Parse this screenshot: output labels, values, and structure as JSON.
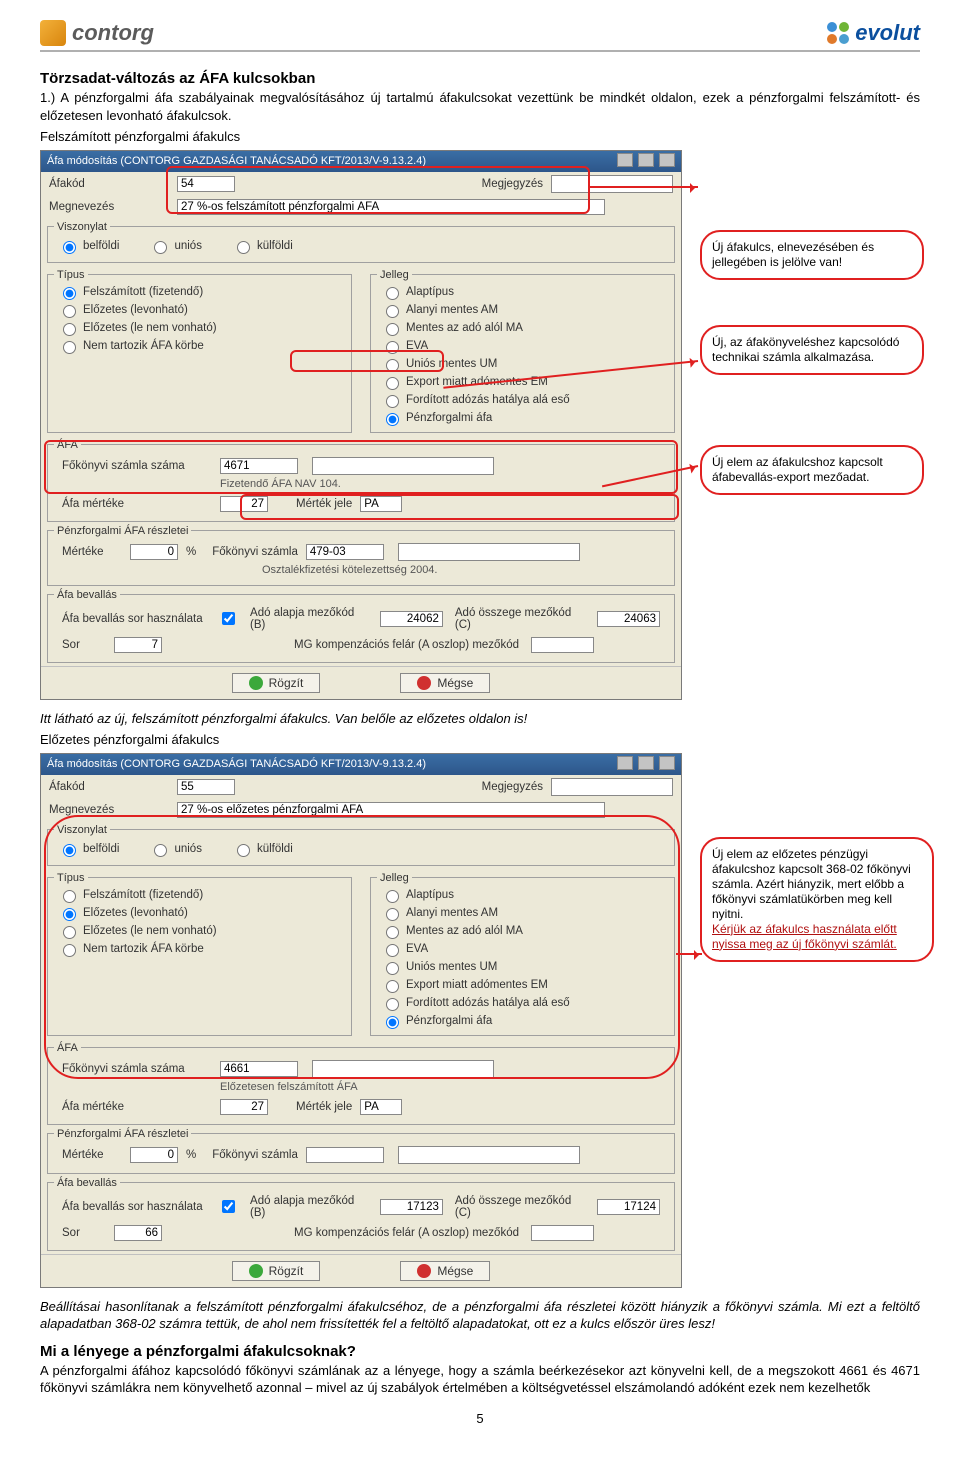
{
  "header": {
    "left_logo": "contorg",
    "right_logo": "evolut"
  },
  "section_title": "Törzsadat-változás az ÁFA kulcsokban",
  "intro_para": "1.) A pénzforgalmi áfa szabályainak megvalósításához új tartalmú áfakulcsokat vezettünk be mindkét oldalon, ezek a pénzforgalmi felszámított- és előzetesen levonható áfakulcsok.",
  "sub1_label": "Felszámított pénzforgalmi áfakulcs",
  "dialog1": {
    "title": "Áfa módosítás (CONTORG GAZDASÁGI TANÁCSADÓ KFT/2013/V-9.13.2.4)",
    "afakod_label": "Áfakód",
    "afakod_value": "54",
    "megjegyzes_label": "Megjegyzés",
    "megnevezes_label": "Megnevezés",
    "megnevezes_value": "27 %-os felszámított pénzforgalmi ÁFA",
    "viszonylat_legend": "Viszonylat",
    "visz_opts": [
      "belföldi",
      "uniós",
      "külföldi"
    ],
    "tipus_legend": "Típus",
    "tipus_opts": [
      "Felszámított (fizetendő)",
      "Előzetes (levonható)",
      "Előzetes (le nem vonható)",
      "Nem tartozik ÁFA körbe"
    ],
    "jelleg_legend": "Jelleg",
    "jelleg_opts": [
      "Alaptípus",
      "Alanyi mentes AM",
      "Mentes az adó alól MA",
      "EVA",
      "Uniós mentes UM",
      "Export miatt adómentes EM",
      "Fordított adózás hatálya alá eső",
      "Pénzforgalmi áfa"
    ],
    "afa_legend": "ÁFA",
    "fokonyvi_label": "Főkönyvi számla száma",
    "fokonyvi_value": "4671",
    "fizetendo_label": "Fizetendő ÁFA NAV 104.",
    "merteke_label": "Áfa mértéke",
    "merteke_value": "27",
    "mertekjele_label": "Mérték jele",
    "mertekjele_value": "PA",
    "penz_legend": "Pénzforgalmi ÁFA részletei",
    "penz_merteke_label": "Mértéke",
    "penz_merteke_value": "0",
    "penz_pct": "%",
    "penz_fk_label": "Főkönyvi számla",
    "penz_fk_value": "479-03",
    "osztalek_label": "Osztalékfizetési kötelezettség 2004.",
    "bevallas_legend": "Áfa bevallás",
    "bev_sor_label": "Áfa bevallás sor használata",
    "bev_sor_chk": true,
    "ado_b_label": "Adó alapja mezőkód (B)",
    "ado_b_value": "24062",
    "ado_c_label": "Adó összege mezőkód (C)",
    "ado_c_value": "24063",
    "sor_label": "Sor",
    "sor_value": "7",
    "mg_label": "MG kompenzációs felár (A oszlop) mezőkód",
    "btn_save": "Rögzít",
    "btn_cancel": "Mégse"
  },
  "callouts1": {
    "a": "Új áfakulcs, elnevezésében és jellegében is jelölve van!",
    "b": "Új, az áfakönyveléshez kapcsolódó technikai számla alkalmazása.",
    "c": "Új elem az áfakulcshoz kapcsolt áfabevallás-export mezőadat."
  },
  "mid_italic": "Itt látható az új, felszámított pénzforgalmi áfakulcs. Van belőle az előzetes oldalon is!",
  "sub2_label": "Előzetes pénzforgalmi áfakulcs",
  "dialog2": {
    "title": "Áfa módosítás (CONTORG GAZDASÁGI TANÁCSADÓ KFT/2013/V-9.13.2.4)",
    "afakod_value": "55",
    "megnevezes_value": "27 %-os előzetes pénzforgalmi ÁFA",
    "fokonyvi_value": "4661",
    "fizetendo_label": "Előzetesen felszámított ÁFA",
    "merteke_value": "27",
    "mertekjele_value": "PA",
    "penz_merteke_value": "0",
    "penz_fk_value": "",
    "ado_b_value": "17123",
    "ado_c_value": "17124",
    "sor_value": "66"
  },
  "callout2": {
    "text1": "Új elem az előzetes pénzügyi áfakulcshoz kapcsolt 368-02 főkönyvi számla. Azért hiányzik, mert előbb a főkönyvi számlatükörben meg kell nyitni.",
    "text2": "Kérjük az áfakulcs használata előtt nyissa meg az új főkönyvi számlát."
  },
  "closing_para": "Beállításai hasonlítanak a felszámított pénzforgalmi áfakulcséhoz, de a pénzforgalmi áfa részletei között hiányzik a főkönyvi számla. Mi ezt a feltöltő alapadatban 368-02 számra tettük, de ahol nem frissítették fel a feltöltő alapadatokat, ott ez a kulcs először üres lesz!",
  "q_title": "Mi a lényege a pénzforgalmi áfakulcsoknak?",
  "q_para": "A pénzforgalmi áfához kapcsolódó főkönyvi számlának az a lényege, hogy a számla beérkezésekor azt könyvelni kell, de a megszokott 4661 és 4671 főkönyvi számlákra nem könyvelhető azonnal – mivel az új szabályok értelmében a költségvetéssel elszámolandó adóként ezek nem kezelhetők",
  "page_number": "5"
}
